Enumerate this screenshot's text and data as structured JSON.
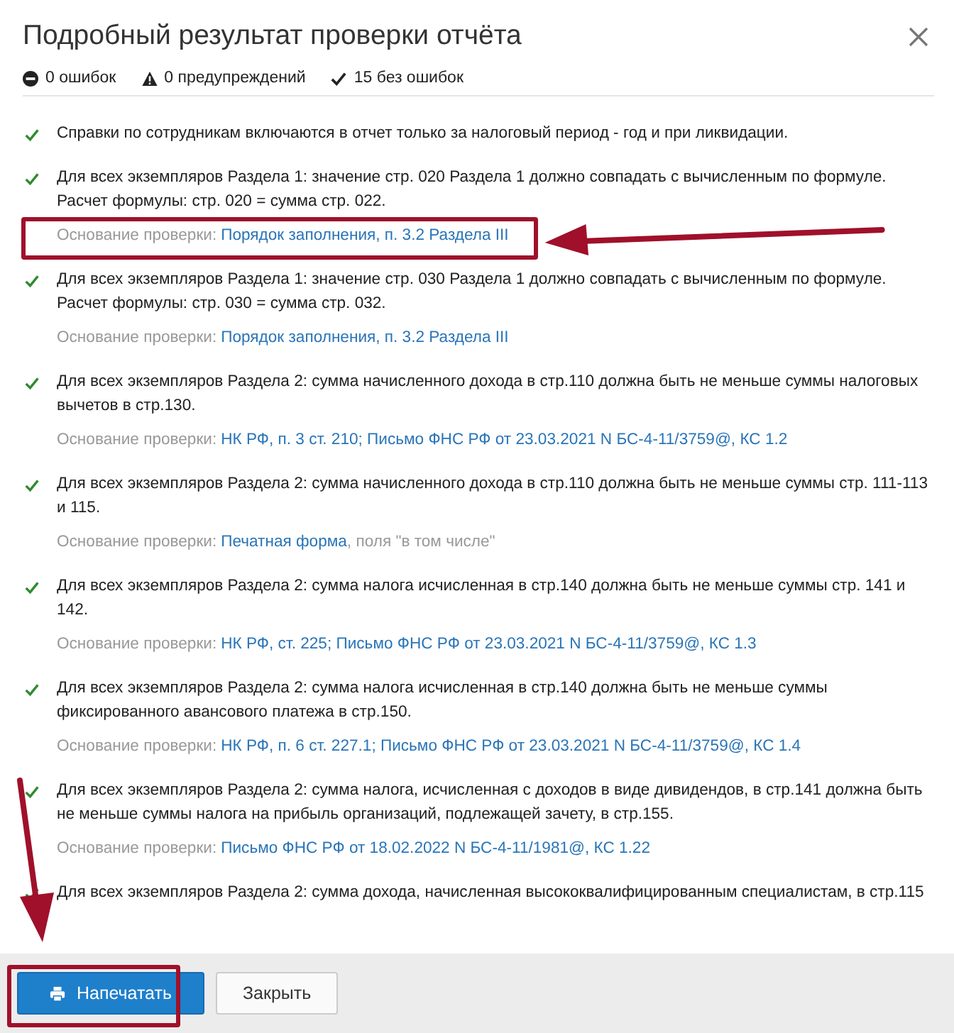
{
  "dialog": {
    "title": "Подробный результат проверки отчёта"
  },
  "summary": [
    {
      "kind": "error",
      "text": "0 ошибок"
    },
    {
      "kind": "warning",
      "text": "0 предупреждений"
    },
    {
      "kind": "ok",
      "text": "15 без ошибок"
    }
  ],
  "checks": [
    {
      "text": "Справки по сотрудникам включаются в отчет только за налоговый период - год и при ликвидации."
    },
    {
      "text": "Для всех экземпляров Раздела 1: значение стр. 020 Раздела 1 должно совпадать с вычисленным по формуле. Расчет формулы: стр. 020 = сумма стр. 022.",
      "basis": {
        "label": "Основание проверки:",
        "link": "Порядок заполнения, п. 3.2 Раздела III"
      }
    },
    {
      "text": "Для всех экземпляров Раздела 1: значение стр. 030 Раздела 1 должно совпадать с вычисленным по формуле. Расчет формулы: стр. 030 = сумма стр. 032.",
      "basis": {
        "label": "Основание проверки:",
        "link": "Порядок заполнения, п. 3.2 Раздела III"
      }
    },
    {
      "text": "Для всех экземпляров Раздела 2: сумма начисленного дохода в стр.110 должна быть не меньше суммы налоговых вычетов в стр.130.",
      "basis": {
        "label": "Основание проверки:",
        "link": "НК РФ, п. 3 ст. 210; Письмо ФНС РФ от 23.03.2021 N БС-4-11/3759@, КС 1.2"
      }
    },
    {
      "text": "Для всех экземпляров Раздела 2: сумма начисленного дохода в стр.110 должна быть не меньше суммы стр. 111-113 и 115.",
      "basis": {
        "label": "Основание проверки:",
        "link": "Печатная форма",
        "suffix": ", поля \"в том числе\""
      }
    },
    {
      "text": "Для всех экземпляров Раздела 2: сумма налога исчисленная в стр.140 должна быть не меньше суммы стр. 141 и 142.",
      "basis": {
        "label": "Основание проверки:",
        "link": "НК РФ, ст. 225; Письмо ФНС РФ от 23.03.2021 N БС-4-11/3759@, КС 1.3"
      }
    },
    {
      "text": "Для всех экземпляров Раздела 2: сумма налога исчисленная в стр.140 должна быть не меньше суммы фиксированного авансового платежа в стр.150.",
      "basis": {
        "label": "Основание проверки:",
        "link": "НК РФ, п. 6 ст. 227.1; Письмо ФНС РФ от 23.03.2021 N БС-4-11/3759@, КС 1.4"
      }
    },
    {
      "text": "Для всех экземпляров Раздела 2: сумма налога, исчисленная с доходов в виде дивидендов, в стр.141 должна быть не меньше суммы налога на прибыль организаций, подлежащей зачету, в стр.155.",
      "basis": {
        "label": "Основание проверки:",
        "link": "Письмо ФНС РФ от 18.02.2022 N БС-4-11/1981@, КС 1.22"
      }
    },
    {
      "text": "Для всех экземпляров Раздела 2: сумма дохода, начисленная высококвалифицированным специалистам, в стр.115"
    }
  ],
  "buttons": [
    {
      "kind": "primary",
      "label": "Напечатать"
    },
    {
      "kind": "default",
      "label": "Закрыть"
    }
  ]
}
